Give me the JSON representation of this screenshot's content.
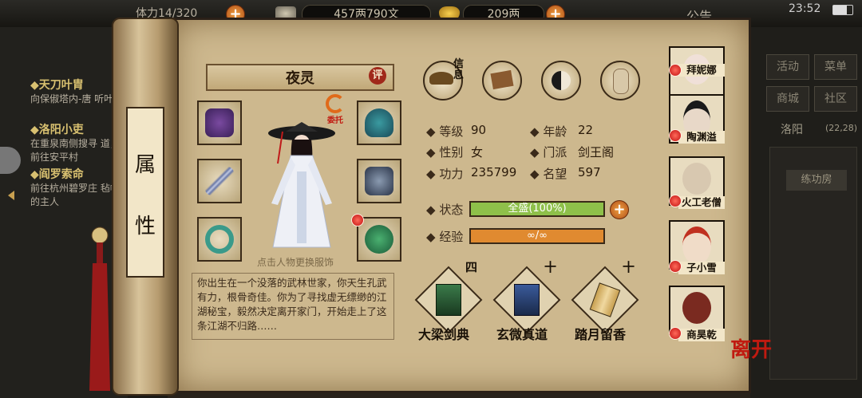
{
  "topbar": {
    "stamina": "体力14/320",
    "money": "457两790文",
    "gold": "209两",
    "notice": "公告",
    "time": "23:52"
  },
  "quests": [
    {
      "title": "◆天刀叶胄",
      "desc": "向保俶塔内-唐 听叶胄"
    },
    {
      "title": "◆洛阳小吏",
      "desc": "在重泉南侧搜寻 道，前往安平村"
    },
    {
      "title": "◆阎罗索命",
      "desc": "前往杭州碧罗庄 毡帽的主人"
    }
  ],
  "right_menu": {
    "buttons": [
      "活动",
      "菜单",
      "商城",
      "社区"
    ],
    "location": "洛阳",
    "coords": "(22,28)",
    "room": "练功房"
  },
  "scroll_title": "属性",
  "character": {
    "name": "夜灵",
    "review_label": "评",
    "entrust_label": "委托",
    "change_hint": "点击人物更换服饰",
    "story": "你出生在一个没落的武林世家，你天生孔武有力，根骨奇佳。你为了寻找虚无缥缈的江湖秘宝，毅然决定离开家门，开始走上了这条江湖不归路……"
  },
  "tabs": {
    "info_label": "信息"
  },
  "stats": {
    "level_label": "等级",
    "level": "90",
    "age_label": "年龄",
    "age": "22",
    "gender_label": "性别",
    "gender": "女",
    "sect_label": "门派",
    "sect": "剑王阁",
    "power_label": "功力",
    "power": "235799",
    "fame_label": "名望",
    "fame": "597",
    "status_label": "状态",
    "status": "全盛(100%)",
    "status_pct": 100,
    "exp_label": "经验",
    "exp": "∞/∞"
  },
  "skills": [
    {
      "name": "大梁剑典",
      "level": "四"
    },
    {
      "name": "玄微真道",
      "level": "十"
    },
    {
      "name": "踏月留香",
      "level": "十"
    }
  ],
  "companions": [
    "拜妮娜",
    "陶渊溢",
    "火工老僧",
    "子小雪",
    "商昊乾"
  ],
  "leave_label": "离开",
  "colors": {
    "status_bar": "#8ec04a",
    "exp_bar": "#e08a30",
    "accent_red": "#c01a10"
  }
}
